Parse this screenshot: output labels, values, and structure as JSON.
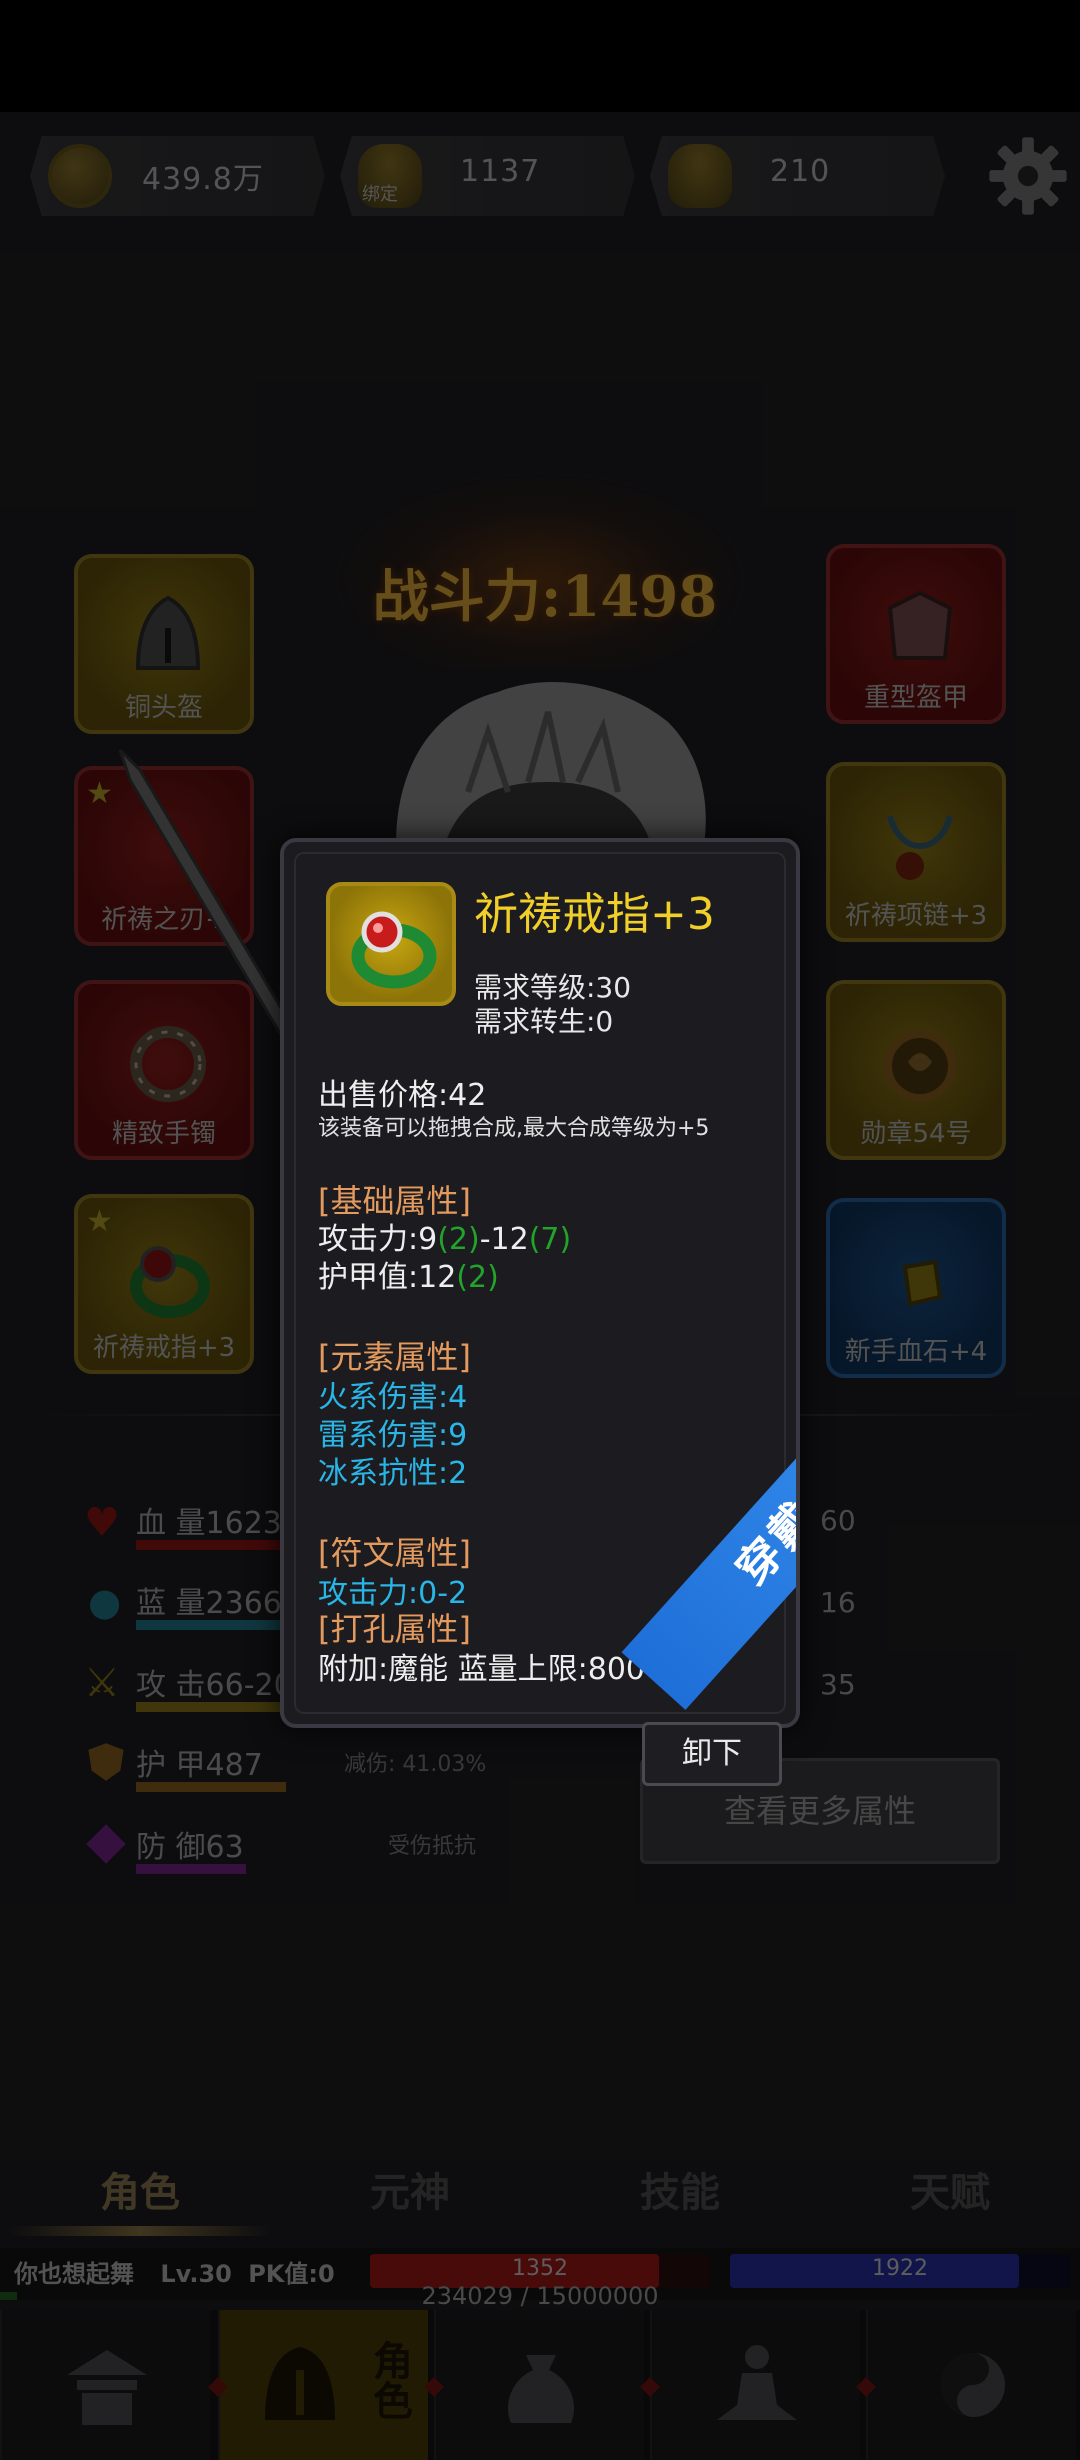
{
  "currencies": [
    {
      "name": "copper-coin",
      "value": "439.8万"
    },
    {
      "name": "bound-gold-ingot",
      "value": "1137",
      "badge": "绑定"
    },
    {
      "name": "gold-ingot",
      "value": "210"
    }
  ],
  "power": {
    "text": "战斗力:1498"
  },
  "equipment": {
    "left": [
      {
        "label": "铜头盔",
        "color": "yellow",
        "starred": false,
        "icon": "helmet-icon"
      },
      {
        "label": "祈祷之刃+",
        "color": "red",
        "starred": true,
        "icon": "blade-icon"
      },
      {
        "label": "精致手镯",
        "color": "red",
        "starred": false,
        "icon": "bracelet-icon"
      },
      {
        "label": "祈祷戒指+3",
        "color": "yellow",
        "starred": true,
        "icon": "ring-icon"
      }
    ],
    "right": [
      {
        "label": "重型盔甲",
        "color": "red",
        "starred": false,
        "icon": "armor-icon"
      },
      {
        "label": "祈祷项链+3",
        "color": "yellow",
        "starred": false,
        "icon": "necklace-icon"
      },
      {
        "label": "勋章54号",
        "color": "yellow",
        "starred": false,
        "icon": "medal-icon"
      },
      {
        "label": "新手血石+4",
        "color": "blue",
        "starred": false,
        "icon": "bloodstone-icon"
      }
    ]
  },
  "stats": [
    {
      "label": "血 量1623",
      "icon": "heart-icon",
      "color": "#7a1616",
      "right": "60"
    },
    {
      "label": "蓝 量2366",
      "icon": "droplet-icon",
      "color": "#1b5c6e",
      "right": "16"
    },
    {
      "label": "攻 击66-20",
      "icon": "sword-icon",
      "color": "#6e5a14",
      "right": "35"
    },
    {
      "label": "护 甲487",
      "icon": "shield-icon",
      "color": "#6e4a14",
      "note": "减伤: 41.03%"
    },
    {
      "label": "防 御63",
      "icon": "defense-icon",
      "color": "#5e1c6e",
      "note": "受伤抵抗"
    }
  ],
  "more_button": "查看更多属性",
  "tabs": [
    "角色",
    "元神",
    "技能",
    "天赋"
  ],
  "active_tab": 0,
  "player": {
    "name": "你也想起舞",
    "level": "Lv.30",
    "pk": "PK值:0",
    "hp": "1352",
    "hp_ratio": 0.85,
    "mp": "1922",
    "mp_ratio": 0.85,
    "exp_text": "234029 / 15000000",
    "exp_ratio": 0.0156
  },
  "bottom_nav": [
    {
      "name": "city-button",
      "icon": "palace-icon"
    },
    {
      "name": "role-button",
      "icon": "helmet-icon",
      "label": "角色",
      "active": true
    },
    {
      "name": "bag-button",
      "icon": "money-bag-icon"
    },
    {
      "name": "meditation-button",
      "icon": "meditation-icon"
    },
    {
      "name": "taiji-button",
      "icon": "taiji-icon"
    }
  ],
  "tooltip": {
    "name": "祈祷戒指+3",
    "req_level": "需求等级:30",
    "req_rebirth": "需求转生:0",
    "price": "出售价格:42",
    "merge_note": "该装备可以拖拽合成,最大合成等级为+5",
    "base_header": "[基础属性]",
    "attack": {
      "prefix": "攻击力:9",
      "bonus1": "(2)",
      "mid": "-12",
      "bonus2": "(7)"
    },
    "armor": {
      "prefix": "护甲值:12",
      "bonus": "(2)"
    },
    "element_header": "[元素属性]",
    "element_lines": [
      "火系伤害:4",
      "雷系伤害:9",
      "冰系抗性:2"
    ],
    "rune_header": "[符文属性]",
    "rune_lines": [
      "攻击力:0-2"
    ],
    "socket_header": "[打孔属性]",
    "socket_line": "附加:魔能 蓝量上限:800",
    "ribbon": "穿戴中",
    "unequip": "卸下"
  }
}
